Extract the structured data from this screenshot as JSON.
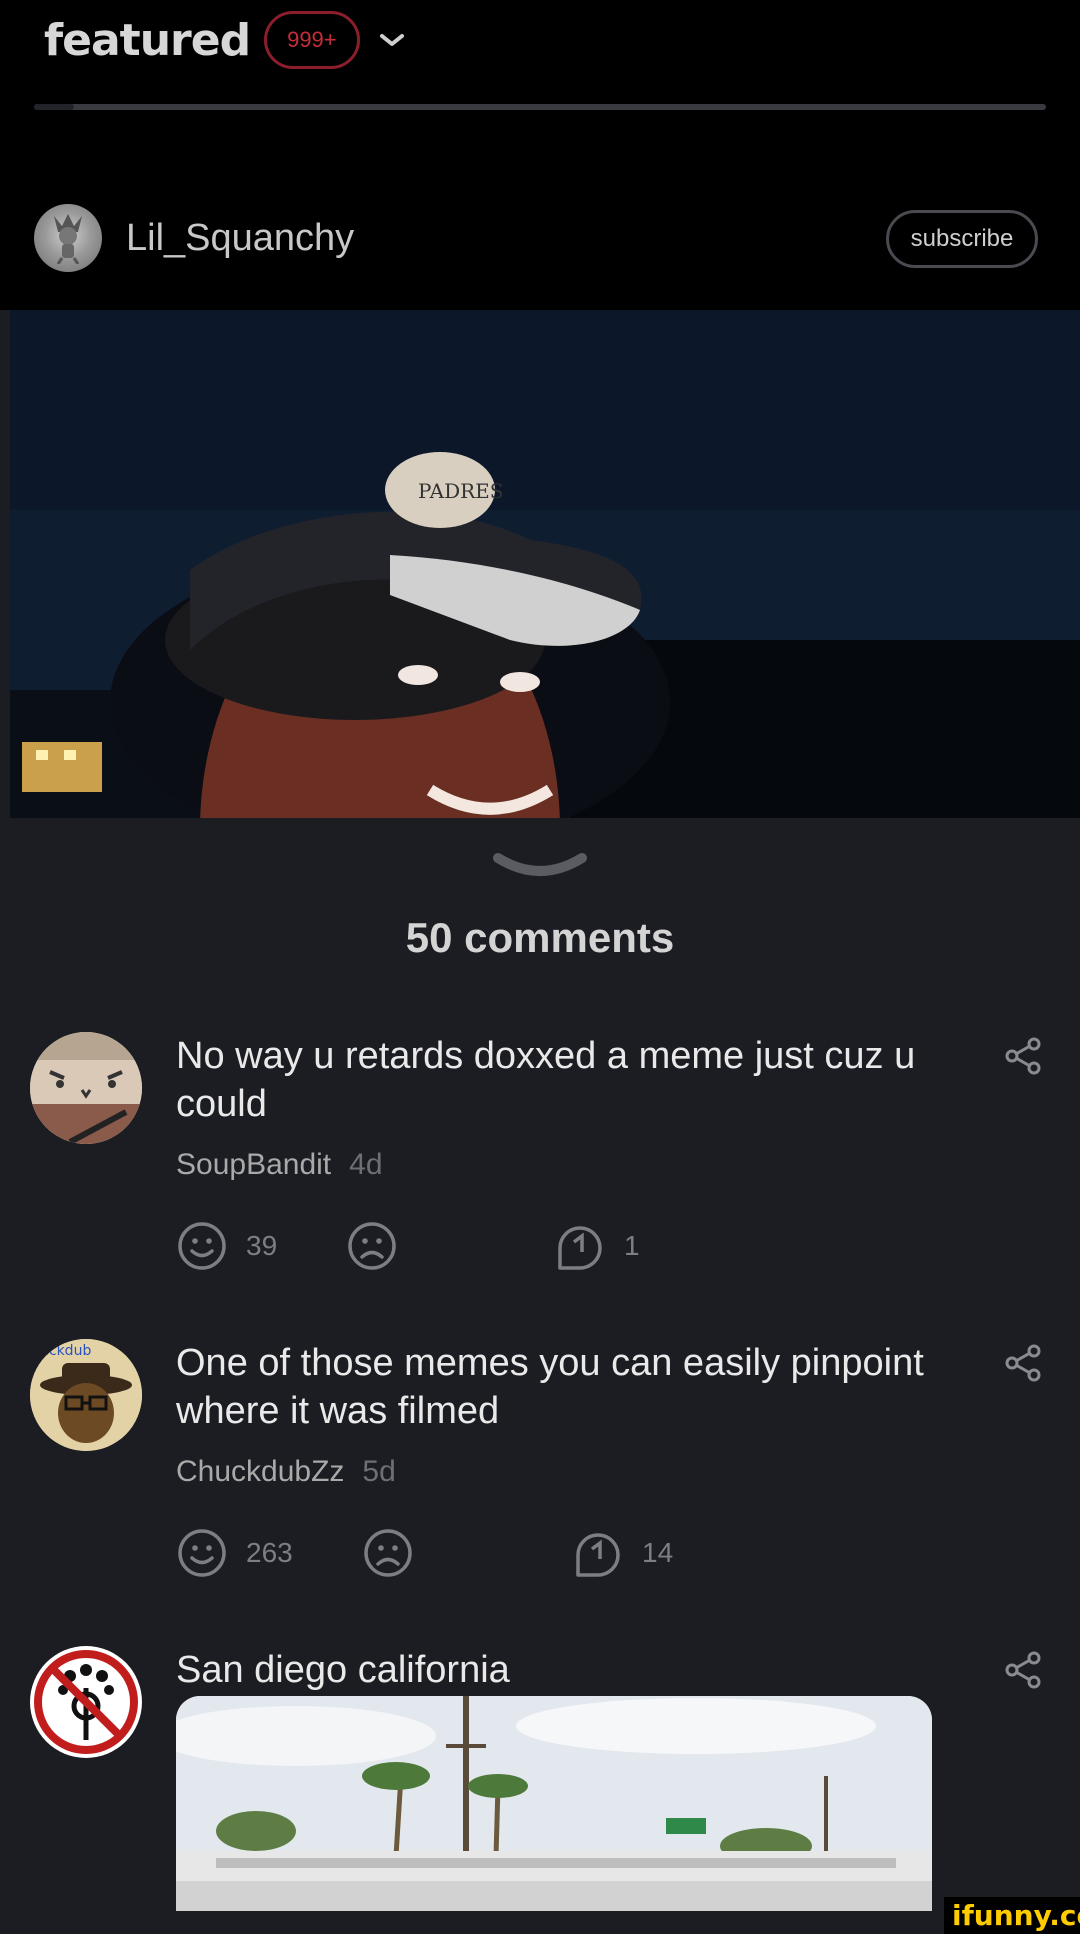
{
  "header": {
    "section_label": "featured",
    "notification_badge": "999+",
    "feed_progress_fraction": 0.04
  },
  "post": {
    "author": "Lil_Squanchy",
    "subscribe_label": "subscribe"
  },
  "comments_count_label": "50 comments",
  "comments": [
    {
      "text": "No way u retards doxxed a meme just cuz u could",
      "author": "SoupBandit",
      "age": "4d",
      "smiles": "39",
      "replies": "1"
    },
    {
      "avatar_text": "uckdub",
      "text": "One of those memes you can easily pinpoint where it was filmed",
      "author": "ChuckdubZz",
      "age": "5d",
      "smiles": "263",
      "replies": "14"
    },
    {
      "text": "San diego california"
    }
  ],
  "watermark": "ifunny.co",
  "colors": {
    "background": "#1c1d22",
    "header_background": "#000000",
    "badge_red": "#c62c3a",
    "icon_gray": "#7d7e84",
    "watermark_yellow": "#ffcc00"
  }
}
